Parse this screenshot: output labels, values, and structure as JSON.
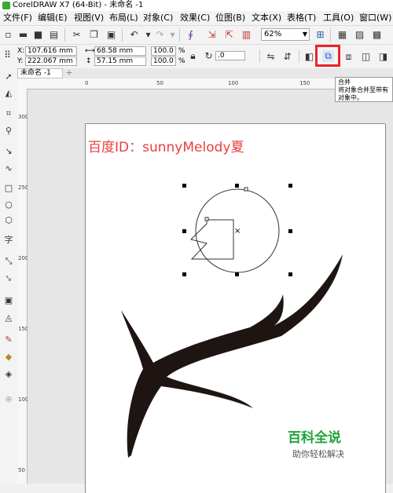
{
  "window": {
    "title": "CorelDRAW X7 (64-Bit) - 未命名 -1"
  },
  "menu": [
    {
      "label": "文件(F)"
    },
    {
      "label": "编辑(E)"
    },
    {
      "label": "视图(V)"
    },
    {
      "label": "布局(L)"
    },
    {
      "label": "对象(C)"
    },
    {
      "label": "效果(C)"
    },
    {
      "label": "位图(B)"
    },
    {
      "label": "文本(X)"
    },
    {
      "label": "表格(T)"
    },
    {
      "label": "工具(O)"
    },
    {
      "label": "窗口(W)"
    }
  ],
  "toolbar": {
    "zoom_value": "62%"
  },
  "properties": {
    "x": "107.616 mm",
    "y": "222.067 mm",
    "width": "68.58 mm",
    "height": "57.15 mm",
    "scale_x": "100.0",
    "scale_y": "100.0",
    "percent": "%",
    "rotation": ".0",
    "x_label": "X:",
    "y_label": "Y:"
  },
  "tabs": [
    {
      "label": "未命名 -1"
    }
  ],
  "add_tab": "+",
  "tooltip": {
    "title": "合并",
    "line1": "将对象合并至带有",
    "line2": "对象中。"
  },
  "ruler": {
    "h_ticks": [
      "0",
      "50",
      "100",
      "150"
    ],
    "v_ticks": [
      "300",
      "250",
      "200",
      "150",
      "100",
      "50"
    ]
  },
  "canvas": {
    "watermark": "百度ID：sunnyMelody夏",
    "brand_name": "百科全说",
    "brand_tagline": "助你轻松解决"
  },
  "colors": {
    "highlight": "#e8262a",
    "watermark": "#e8403d",
    "brand": "#21a33a",
    "branch": "#1e1512"
  },
  "icons": [
    "new-icon",
    "open-icon",
    "save-icon",
    "print-icon",
    "cut-icon",
    "copy-icon",
    "paste-icon",
    "undo-icon",
    "redo-icon",
    "import-icon",
    "export-icon",
    "zoom-icon",
    "combine-icon"
  ]
}
